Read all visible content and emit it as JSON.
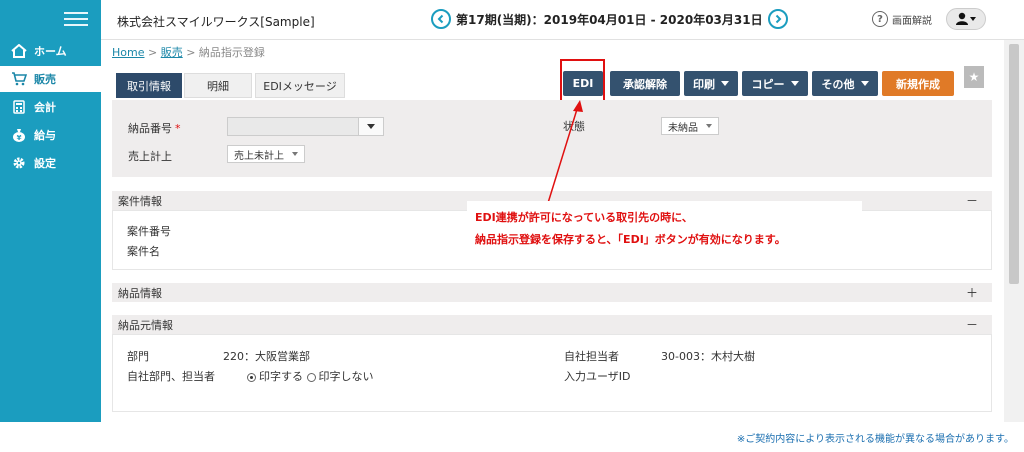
{
  "sidebar": {
    "items": [
      {
        "label": "ホーム",
        "icon": "home-icon"
      },
      {
        "label": "販売",
        "icon": "cart-icon"
      },
      {
        "label": "会計",
        "icon": "calculator-icon"
      },
      {
        "label": "給与",
        "icon": "money-bag-icon"
      },
      {
        "label": "設定",
        "icon": "gear-icon"
      }
    ]
  },
  "header": {
    "company": "株式会社スマイルワークス[Sample]",
    "period": "第17期(当期)：2019年04月01日 - 2020年03月31日",
    "help_label": "画面解説"
  },
  "breadcrumb": {
    "home": "Home",
    "sep1": ">",
    "sales": "販売",
    "sep2": ">",
    "current": "納品指示登録"
  },
  "tabs": [
    {
      "label": "取引情報",
      "active": true
    },
    {
      "label": "明細",
      "active": false
    },
    {
      "label": "EDIメッセージ",
      "active": false
    }
  ],
  "toolbar": {
    "edi": "EDI",
    "approve_cancel": "承認解除",
    "print": "印刷",
    "copy": "コピー",
    "other": "その他",
    "new": "新規作成"
  },
  "form": {
    "delivery_no_label": "納品番号",
    "required_mark": "*",
    "delivery_no_value": "",
    "status_label": "状態",
    "status_value": "未納品",
    "sales_label": "売上計上",
    "sales_value": "売上未計上"
  },
  "sections": {
    "project": {
      "title": "案件情報",
      "toggle": "－",
      "fields": [
        "案件番号",
        "案件名"
      ]
    },
    "delivery": {
      "title": "納品情報",
      "toggle": "＋"
    },
    "source": {
      "title": "納品元情報",
      "toggle": "－",
      "dept_label": "部門",
      "dept_value": "220：大阪営業部",
      "print_label": "自社部門、担当者",
      "print_on": "印字する",
      "print_off": "印字しない",
      "staff_label": "自社担当者",
      "staff_value": "30-003：木村大樹",
      "input_user_label": "入力ユーザID"
    }
  },
  "annotation": {
    "line1": "EDI連携が許可になっている取引先の時に、",
    "line2": "納品指示登録を保存すると、「EDI」ボタンが有効になります。"
  },
  "footnote": "※ご契約内容により表示される機能が異なる場合があります。",
  "colors": {
    "sidebar": "#1b9dbf",
    "button": "#34526f",
    "new_button": "#e07a27",
    "highlight": "#e01010"
  }
}
